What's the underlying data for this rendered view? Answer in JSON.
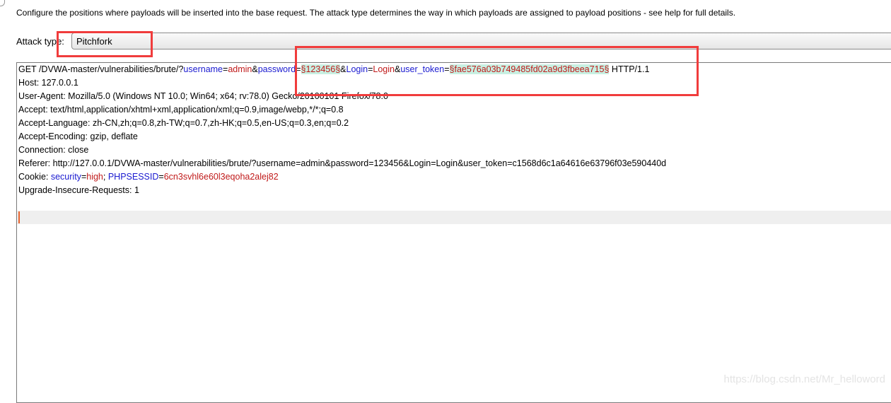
{
  "intro": "Configure the positions where payloads will be inserted into the base request. The attack type determines the way in which payloads are assigned to payload positions - see help for full details.",
  "attack_type": {
    "label": "Attack type:",
    "value": "Pitchfork"
  },
  "request_lines": [
    [
      [
        "p",
        "GET /DVWA-master/vulnerabilities/brute/?"
      ],
      [
        "n",
        "username"
      ],
      [
        "p",
        "="
      ],
      [
        "v",
        "admin"
      ],
      [
        "p",
        "&"
      ],
      [
        "n",
        "password"
      ],
      [
        "p",
        "="
      ],
      [
        "m",
        "§123456§"
      ],
      [
        "p",
        "&"
      ],
      [
        "n",
        "Login"
      ],
      [
        "p",
        "="
      ],
      [
        "v",
        "Login"
      ],
      [
        "p",
        "&"
      ],
      [
        "n",
        "user_token"
      ],
      [
        "p",
        "="
      ],
      [
        "m",
        "§fae576a03b749485fd02a9d3fbeea715§"
      ],
      [
        "p",
        " HTTP/1.1"
      ]
    ],
    [
      [
        "p",
        "Host: 127.0.0.1"
      ]
    ],
    [
      [
        "p",
        "User-Agent: Mozilla/5.0 (Windows NT 10.0; Win64; x64; rv:78.0) Gecko/20100101 Firefox/78.0"
      ]
    ],
    [
      [
        "p",
        "Accept: text/html,application/xhtml+xml,application/xml;q=0.9,image/webp,*/*;q=0.8"
      ]
    ],
    [
      [
        "p",
        "Accept-Language: zh-CN,zh;q=0.8,zh-TW;q=0.7,zh-HK;q=0.5,en-US;q=0.3,en;q=0.2"
      ]
    ],
    [
      [
        "p",
        "Accept-Encoding: gzip, deflate"
      ]
    ],
    [
      [
        "p",
        "Connection: close"
      ]
    ],
    [
      [
        "p",
        "Referer: http://127.0.0.1/DVWA-master/vulnerabilities/brute/?username=admin&password=123456&Login=Login&user_token=c1568d6c1a64616e63796f03e590440d"
      ]
    ],
    [
      [
        "p",
        "Cookie: "
      ],
      [
        "n",
        "security"
      ],
      [
        "p",
        "="
      ],
      [
        "v",
        "high"
      ],
      [
        "p",
        "; "
      ],
      [
        "n",
        "PHPSESSID"
      ],
      [
        "p",
        "="
      ],
      [
        "v",
        "6cn3svhl6e60l3eqoha2alej82"
      ]
    ],
    [
      [
        "p",
        "Upgrade-Insecure-Requests: 1"
      ]
    ],
    [],
    []
  ],
  "watermark": "https://blog.csdn.net/Mr_helloword",
  "colors": {
    "param_name": "#1a1ad0",
    "param_value": "#c01a1a",
    "payload_marker_bg": "#c8f0e2",
    "annotation": "#f03c3c"
  }
}
